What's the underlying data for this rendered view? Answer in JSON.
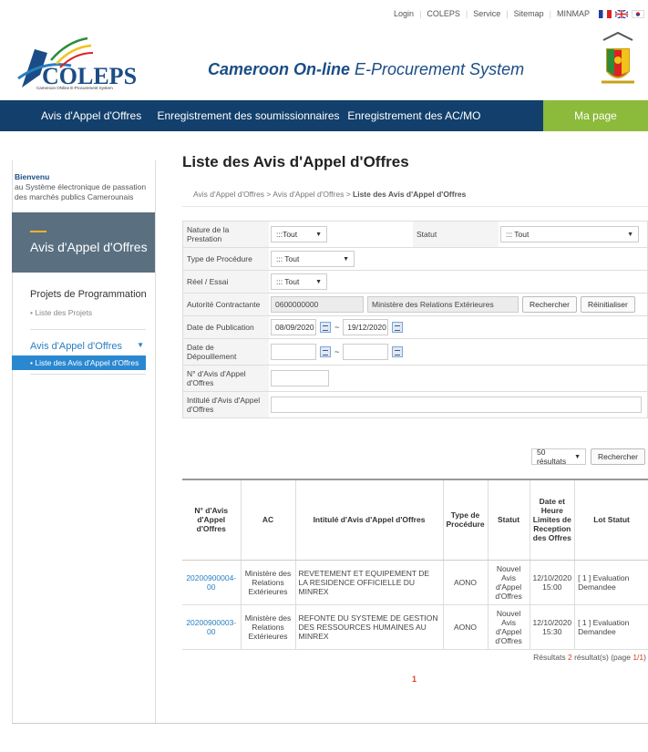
{
  "topbar": {
    "links": [
      "Login",
      "COLEPS",
      "Service",
      "Sitemap",
      "MINMAP"
    ]
  },
  "header": {
    "logo_text": "COLEPS",
    "logo_sub": "Cameroon ONline E-Procurement System",
    "tagline_bold": "Cameroon On-line",
    "tagline_rest": " E-Procurement System"
  },
  "nav": {
    "items": [
      "Avis d'Appel d'Offres",
      "Enregistrement des soumissionnaires",
      "Enregistrement des AC/MO"
    ],
    "mapage": "Ma page"
  },
  "sidebar": {
    "welcome_title": "Bienvenu",
    "welcome_text": "au Système électronique de passation des marchés publics Camerounais",
    "box_title": "Avis d'Appel d'Offres",
    "cat1": "Projets de Programmation",
    "cat1_sub": "Liste des Projets",
    "cat2": "Avis d'Appel d'Offres",
    "cat2_active": "Liste des Avis d'Appel d'Offres"
  },
  "main": {
    "title": "Liste des Avis d'Appel d'Offres",
    "breadcrumb": [
      "Avis d'Appel d'Offres",
      "Avis d'Appel d'Offres",
      "Liste des Avis d'Appel d'Offres"
    ]
  },
  "search": {
    "nature_label": "Nature de la Prestation",
    "nature_value": ":::Tout",
    "statut_label": "Statut",
    "statut_value": "::: Tout",
    "procedure_label": "Type de Procédure",
    "procedure_value": "::: Tout",
    "reel_label": "Réel / Essai",
    "reel_value": "::: Tout",
    "autorite_label": "Autorité Contractante",
    "autorite_code": "0600000000",
    "autorite_name": "Ministère des Relations Extérieures",
    "rechercher": "Rechercher",
    "reinitialiser": "Réinitialiser",
    "pub_label": "Date de Publication",
    "pub_from": "08/09/2020",
    "pub_to": "19/12/2020",
    "depouil_label": "Date de Dépouillement",
    "numero_label": "N° d'Avis d'Appel d'Offres",
    "intitule_label": "Intitulé d'Avis d'Appel d'Offres"
  },
  "results_bar": {
    "per_page": "50 résultats",
    "button": "Rechercher"
  },
  "table": {
    "headers": [
      "N° d'Avis d'Appel d'Offres",
      "AC",
      "Intitulé d'Avis d'Appel d'Offres",
      "Type de Procédure",
      "Statut",
      "Date et Heure Limites de Reception des Offres",
      "Lot Statut"
    ],
    "rows": [
      {
        "num": "20200900004-00",
        "ac": "Ministère des Relations Extérieures",
        "intitule": "REVETEMENT ET EQUIPEMENT DE LA RESIDENCE OFFICIELLE DU MINREX",
        "type": "AONO",
        "statut": "Nouvel Avis d'Appel d'Offres",
        "date": "12/10/2020 15:00",
        "lot": "[ 1 ] Evaluation Demandee"
      },
      {
        "num": "20200900003-00",
        "ac": "Ministère des Relations Extérieures",
        "intitule": "REFONTE DU SYSTEME DE GESTION DES RESSOURCES HUMAINES AU MINREX",
        "type": "AONO",
        "statut": "Nouvel Avis d'Appel d'Offres",
        "date": "12/10/2020 15:30",
        "lot": "[ 1 ] Evaluation Demandee"
      }
    ]
  },
  "summary": {
    "prefix": "Résultats",
    "count": "2",
    "mid": "résultat(s) (page",
    "page": "1/1",
    "suffix": ")"
  },
  "pager": {
    "current": "1"
  }
}
